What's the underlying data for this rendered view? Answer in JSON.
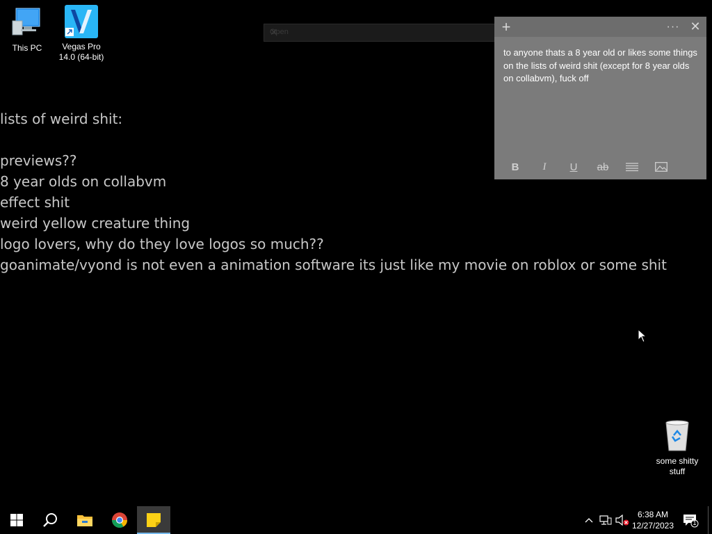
{
  "desktop": {
    "icons": [
      {
        "label": "This PC",
        "icon": "computer-icon"
      },
      {
        "label": "Vegas Pro 14.0 (64-bit)",
        "icon": "vegas-pro-icon"
      },
      {
        "label": "some shitty stuff",
        "icon": "recycle-bin-icon"
      }
    ],
    "wallpaper_lines": [
      "lists of weird shit:",
      "",
      "previews??",
      "8 year olds on collabvm",
      "effect shit",
      "weird yellow creature thing",
      "logo lovers, why do they love logos so much??",
      "goanimate/vyond is not even a animation software its just like my movie on roblox or some shit"
    ]
  },
  "open_dialog": {
    "text": "Open"
  },
  "sticky_note": {
    "text": "to anyone thats a 8 year old or likes some things on the lists of weird shit (except for 8 year olds on collabvm), fuck off",
    "header": {
      "add": "+",
      "menu": "···",
      "close": "✕"
    },
    "toolbar": {
      "bold": "B",
      "italic": "I",
      "underline": "U",
      "strikethrough": "ab",
      "bullets": "list-icon",
      "image": "image-icon"
    },
    "colors": {
      "body": "#7b7b7b",
      "header": "#6d6d6d"
    }
  },
  "taskbar": {
    "apps": [
      "start-icon",
      "search-icon",
      "file-explorer-icon",
      "chrome-icon",
      "sticky-notes-icon"
    ],
    "clock": {
      "time": "6:38 AM",
      "date": "12/27/2023"
    },
    "notification_count": "1"
  }
}
